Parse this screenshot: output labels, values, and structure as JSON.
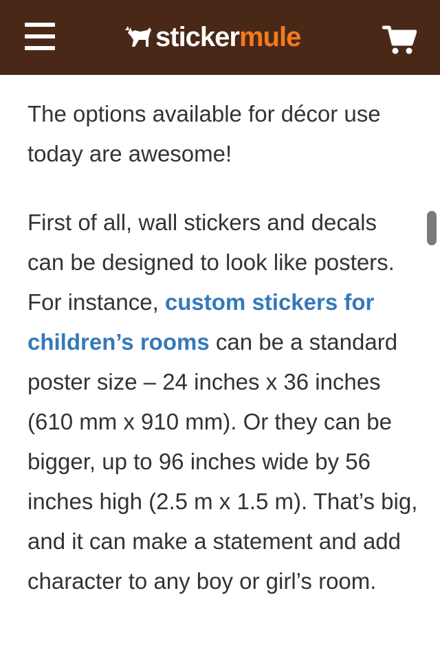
{
  "header": {
    "logo_part1": "sticker",
    "logo_part2": "mule",
    "menu_icon": "hamburger-icon",
    "cart_icon": "shopping-cart-icon",
    "bg_color": "#4a2818",
    "accent_color": "#f47a20"
  },
  "article": {
    "paragraph1": "The options available for décor use today are awesome!",
    "paragraph2_intro": "First of all, wall stickers and decals can be designed to look like posters. For instance, ",
    "paragraph2_link": "custom stickers for children’s rooms",
    "paragraph2_rest": " can be a standard poster size – 24 inches x 36 inches (610 mm x 910 mm). Or they can be bigger, up to 96 inches wide by 56 inches high (2.5 m x 1.5 m). That’s big, and it can make a statement and add character to any boy or girl’s room.",
    "link_color": "#3579b9",
    "text_color": "#333333"
  }
}
